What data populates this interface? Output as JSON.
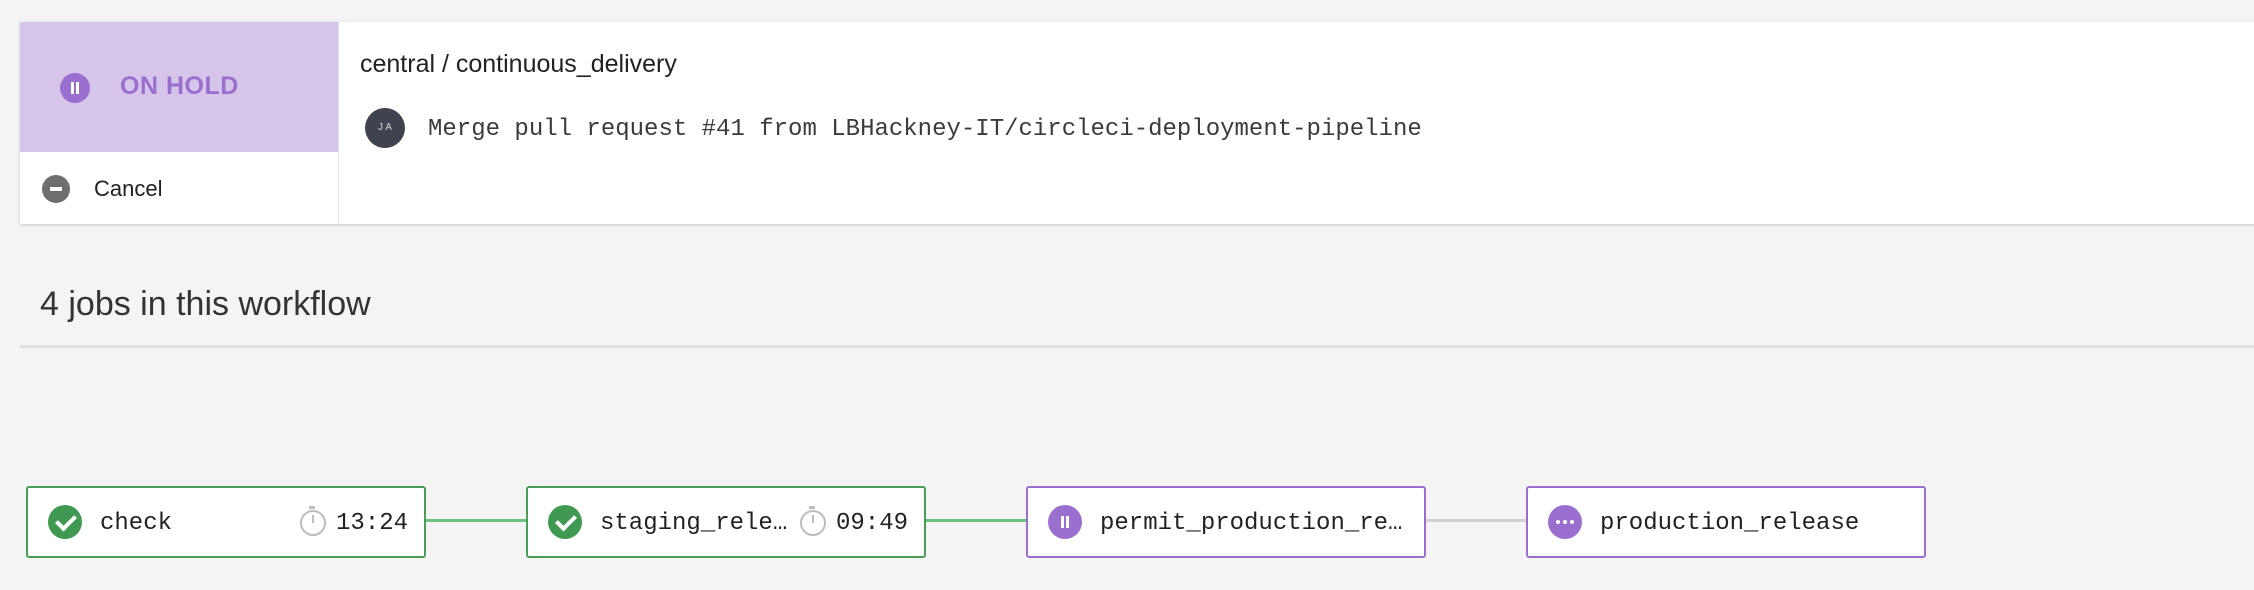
{
  "workflow": {
    "status_label": "ON HOLD",
    "cancel_label": "Cancel",
    "project_title": "central / continuous_delivery",
    "avatar_initials": "J A",
    "commit_message": "Merge pull request #41 from LBHackney-IT/circleci-deployment-pipeline"
  },
  "jobs_heading": "4 jobs in this workflow",
  "jobs": [
    {
      "name": "check",
      "status": "success",
      "duration": "13:24"
    },
    {
      "name": "staging_rele…",
      "status": "success",
      "duration": "09:49"
    },
    {
      "name": "permit_production_re…",
      "status": "on-hold",
      "duration": ""
    },
    {
      "name": "production_release",
      "status": "queued",
      "duration": ""
    }
  ],
  "colors": {
    "success": "#3f9950",
    "on_hold": "#9a6fcf",
    "on_hold_bg": "#d5c5e8",
    "connector_done": "#6cc17d",
    "connector_pending": "#d0d0d0"
  }
}
